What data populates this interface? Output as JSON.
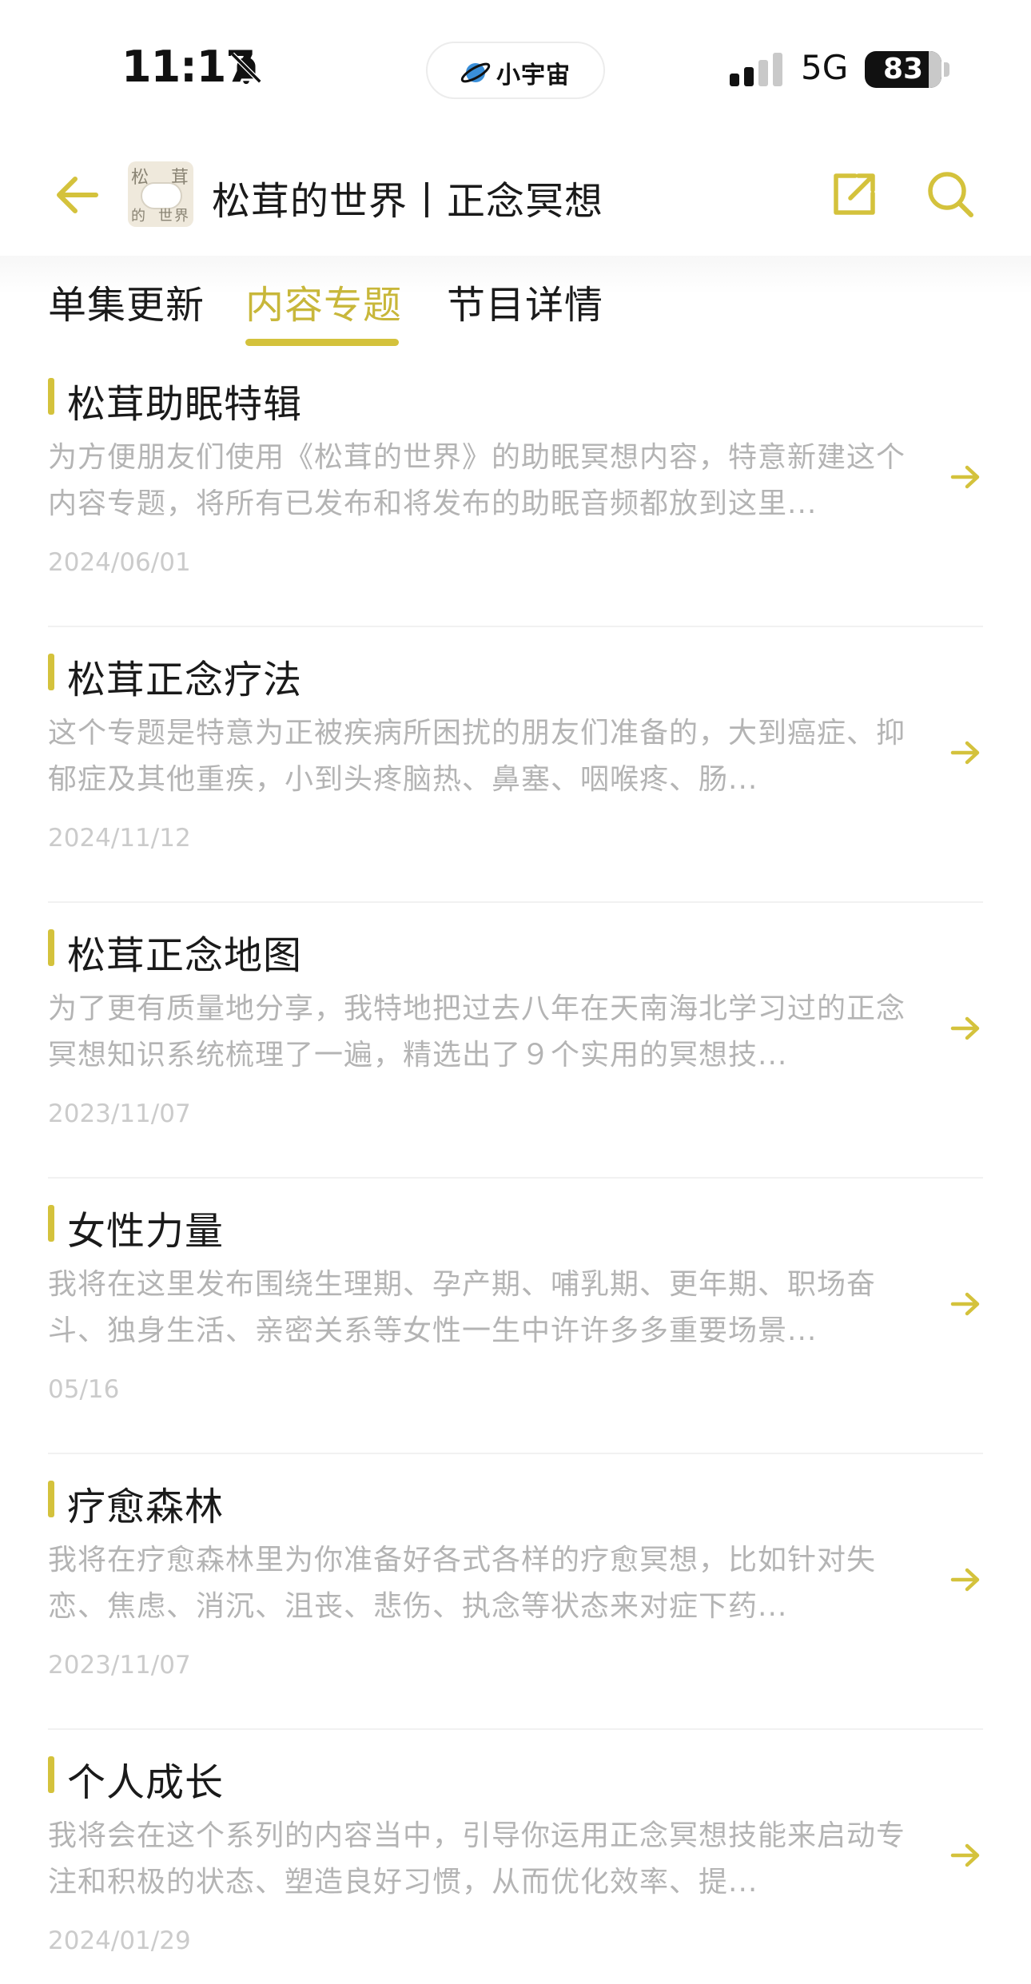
{
  "status_bar": {
    "time": "11:17",
    "island_label": "小宇宙",
    "network": "5G",
    "battery": "83",
    "battery_level": 0.83
  },
  "header": {
    "avatar_chars": [
      "松",
      "茸",
      "的",
      "世",
      "界"
    ],
    "title": "松茸的世界丨正念冥想"
  },
  "tabs": [
    {
      "label": "单集更新",
      "active": false
    },
    {
      "label": "内容专题",
      "active": true
    },
    {
      "label": "节目详情",
      "active": false
    }
  ],
  "topics": [
    {
      "title": "松茸助眠特辑",
      "description": "为方便朋友们使用《松茸的世界》的助眠冥想内容，特意新建这个内容专题，将所有已发布和将发布的助眠音频都放到这里...",
      "date": "2024/06/01"
    },
    {
      "title": "松茸正念疗法",
      "description": "这个专题是特意为正被疾病所困扰的朋友们准备的，大到癌症、抑郁症及其他重疾，小到头疼脑热、鼻塞、咽喉疼、肠...",
      "date": "2024/11/12"
    },
    {
      "title": "松茸正念地图",
      "description": "为了更有质量地分享，我特地把过去八年在天南海北学习过的正念冥想知识系统梳理了一遍，精选出了９个实用的冥想技...",
      "date": "2023/11/07"
    },
    {
      "title": "女性力量",
      "description": "我将在这里发布围绕生理期、孕产期、哺乳期、更年期、职场奋斗、独身生活、亲密关系等女性一生中许许多多重要场景...",
      "date": "05/16"
    },
    {
      "title": "疗愈森林",
      "description": "我将在疗愈森林里为你准备好各式各样的疗愈冥想，比如针对失恋、焦虑、消沉、沮丧、悲伤、执念等状态来对症下药...",
      "date": "2023/11/07"
    },
    {
      "title": "个人成长",
      "description": "我将会在这个系列的内容当中，引导你运用正念冥想技能来启动专注和积极的状态、塑造良好习惯，从而优化效率、提...",
      "date": "2024/01/29"
    }
  ],
  "colors": {
    "accent": "#d4c23c",
    "accent_text": "#c8b73a",
    "secondary_text": "#b4b4b4"
  },
  "icons": {
    "back": "arrow-left-icon",
    "share": "share-icon",
    "search": "search-icon",
    "row_arrow": "arrow-right-icon",
    "silent": "bell-slash-icon"
  }
}
